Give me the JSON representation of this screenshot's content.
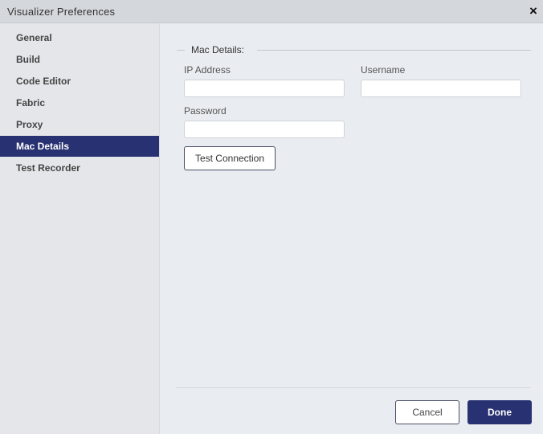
{
  "window": {
    "title": "Visualizer Preferences",
    "close_icon": "×"
  },
  "sidebar": {
    "items": [
      {
        "label": "General",
        "active": false
      },
      {
        "label": "Build",
        "active": false
      },
      {
        "label": "Code Editor",
        "active": false
      },
      {
        "label": "Fabric",
        "active": false
      },
      {
        "label": "Proxy",
        "active": false
      },
      {
        "label": "Mac Details",
        "active": true
      },
      {
        "label": "Test Recorder",
        "active": false
      }
    ]
  },
  "main": {
    "section_title": "Mac Details:",
    "fields": {
      "ip_address": {
        "label": "IP Address",
        "value": "",
        "placeholder": ""
      },
      "username": {
        "label": "Username",
        "value": "",
        "placeholder": ""
      },
      "password": {
        "label": "Password",
        "value": "",
        "placeholder": ""
      }
    },
    "test_connection_label": "Test Connection"
  },
  "footer": {
    "cancel_label": "Cancel",
    "done_label": "Done"
  },
  "colors": {
    "accent": "#283171",
    "background": "#e9ecef",
    "sidebar": "#e4e6e9"
  }
}
